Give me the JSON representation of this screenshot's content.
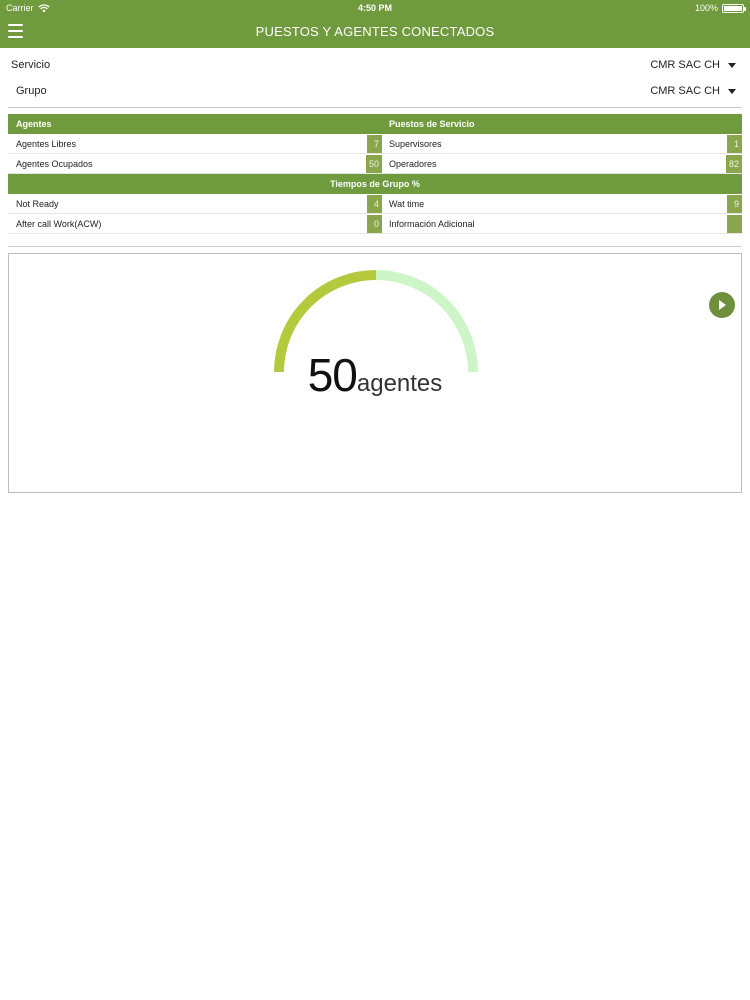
{
  "status_bar": {
    "carrier": "Carrier",
    "time": "4:50 PM",
    "battery": "100%",
    "battery_level": 1.0
  },
  "header": {
    "title": "PUESTOS Y AGENTES CONECTADOS"
  },
  "filters": {
    "servicio": {
      "label": "Servicio",
      "value": "CMR SAC CH"
    },
    "grupo": {
      "label": "Grupo",
      "value": "CMR SAC CH"
    }
  },
  "agentes": {
    "header": "Agentes",
    "rows": [
      {
        "label": "Agentes Libres",
        "value": "7"
      },
      {
        "label": "Agentes Ocupados",
        "value": "50"
      }
    ]
  },
  "puestos": {
    "header": "Puestos de Servicio",
    "rows": [
      {
        "label": "Supervisores",
        "value": "1"
      },
      {
        "label": "Operadores",
        "value": "82"
      }
    ]
  },
  "tiempos": {
    "header": "Tiempos de Grupo %",
    "left": [
      {
        "label": "Not Ready",
        "value": "4"
      },
      {
        "label": "After call Work(ACW)",
        "value": "0"
      }
    ],
    "right": [
      {
        "label": "Wat time",
        "value": "9"
      },
      {
        "label": "Información Adicional",
        "value": ""
      }
    ]
  },
  "gauge": {
    "value": "50",
    "unit": "agentes",
    "fraction": 0.5,
    "colors": {
      "filled": "#b5c93c",
      "remaining": "#cdf5c8"
    }
  },
  "colors": {
    "brand": "#6f9a3e",
    "value_badge": "#8aa64d",
    "play_button": "#6f8f3d"
  }
}
